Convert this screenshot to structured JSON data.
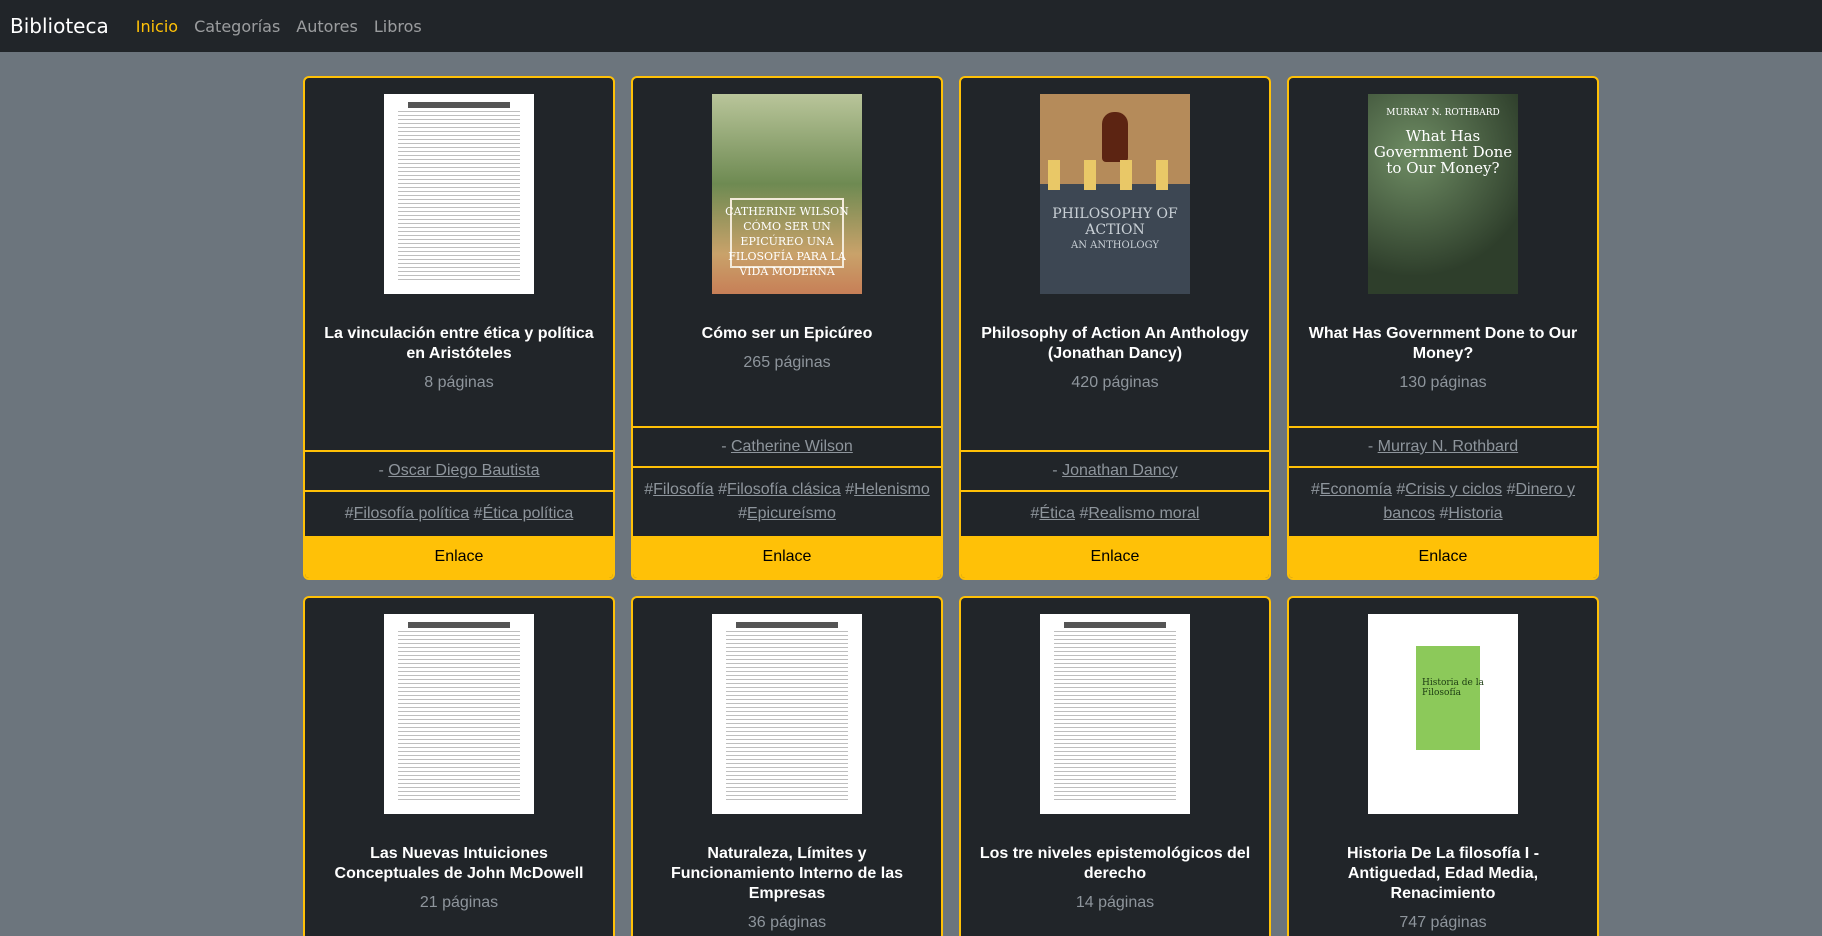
{
  "navbar": {
    "brand": "Biblioteca",
    "links": [
      "Inicio",
      "Categorías",
      "Autores",
      "Libros"
    ],
    "active": "Inicio"
  },
  "colors": {
    "accent": "#ffc107",
    "card_bg": "#212529",
    "page_bg": "#6c757d"
  },
  "books": [
    {
      "title": "La vinculación entre ética y política en Aristóteles",
      "pages": "8 páginas",
      "author_prefix": "- ",
      "author": "Oscar Diego Bautista",
      "tags": [
        "Filosofía política",
        "Ética política"
      ],
      "link": "Enlace"
    },
    {
      "title": "Cómo ser un Epicúreo",
      "pages": "265 páginas",
      "author_prefix": "- ",
      "author": "Catherine Wilson",
      "tags": [
        "Filosofía",
        "Filosofía clásica",
        "Helenismo",
        "Epicureísmo"
      ],
      "link": "Enlace",
      "cover_text": "CATHERINE WILSON CÓMO SER UN EPICÚREO UNA FILOSOFÍA PARA LA VIDA MODERNA"
    },
    {
      "title": "Philosophy of Action An Anthology (Jonathan Dancy)",
      "pages": "420 páginas",
      "author_prefix": "- ",
      "author": "Jonathan Dancy",
      "tags": [
        "Ética",
        "Realismo moral"
      ],
      "link": "Enlace",
      "cover_text": "PHILOSOPHY OF ACTION",
      "cover_sub": "AN ANTHOLOGY"
    },
    {
      "title": "What Has Government Done to Our Money?",
      "pages": "130 páginas",
      "author_prefix": "- ",
      "author": "Murray N. Rothbard",
      "tags": [
        "Economía",
        "Crisis y ciclos",
        "Dinero y bancos",
        "Historia"
      ],
      "link": "Enlace",
      "cover_author": "MURRAY N. ROTHBARD",
      "cover_text": "What Has Government Done to Our Money?"
    },
    {
      "title": "Las Nuevas Intuiciones Conceptuales de John McDowell",
      "pages": "21 páginas"
    },
    {
      "title": "Naturaleza, Límites y Funcionamiento Interno de las Empresas",
      "pages": "36 páginas"
    },
    {
      "title": "Los tre niveles epistemológicos del derecho",
      "pages": "14 páginas"
    },
    {
      "title": "Historia De La filosofía I - Antiguedad, Edad Media, Renacimiento",
      "pages": "747 páginas",
      "cover_text": "Historia de la Filosofía"
    }
  ]
}
